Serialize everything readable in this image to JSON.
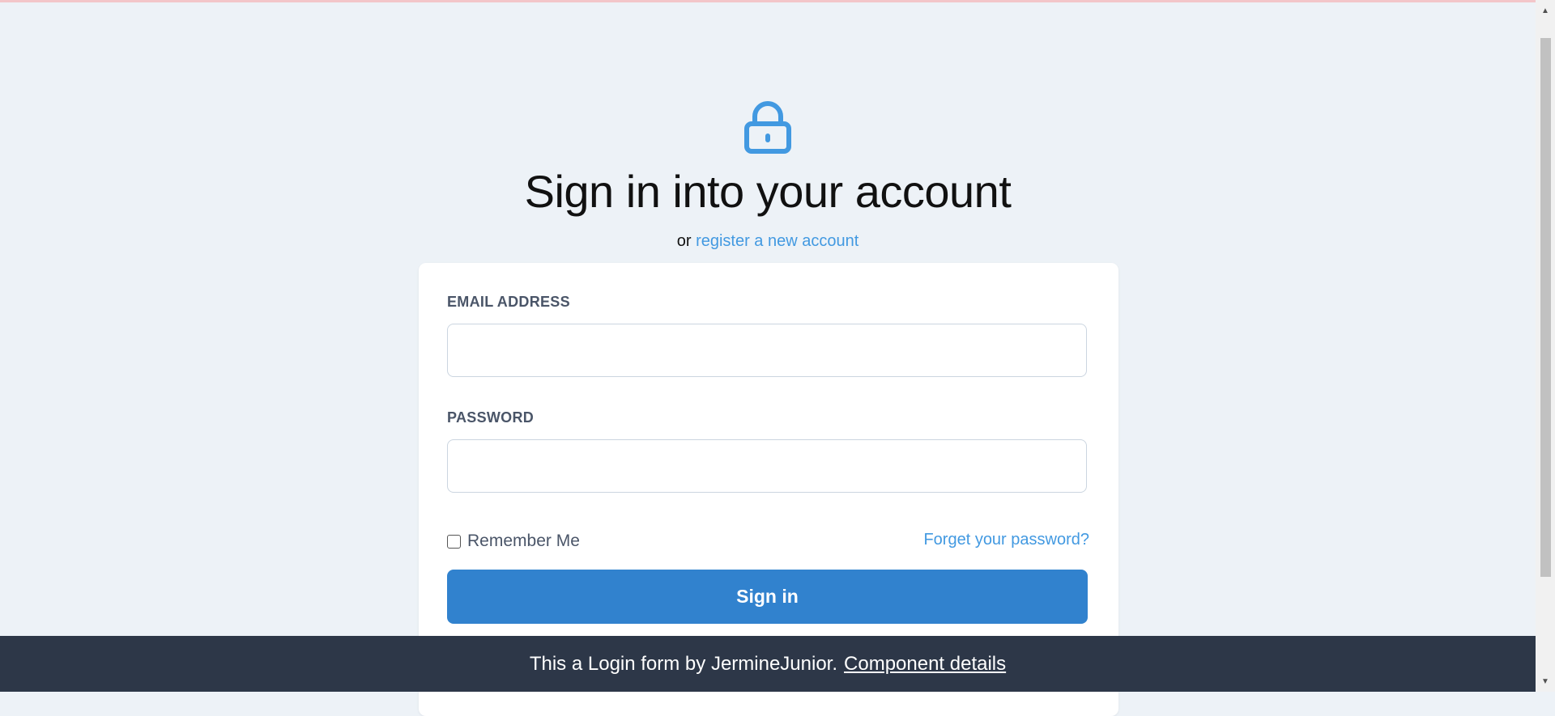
{
  "header": {
    "title": "Sign in into your account",
    "subtitle_prefix": "or",
    "register_link": "register a new account",
    "icon": "lock-icon"
  },
  "form": {
    "email_label": "EMAIL ADDRESS",
    "email_value": "",
    "password_label": "PASSWORD",
    "password_value": "",
    "remember_label": "Remember Me",
    "remember_checked": false,
    "forgot_link": "Forget your password?",
    "submit_label": "Sign in"
  },
  "footer": {
    "text": "This a Login form by JermineJunior.",
    "link": "Component details"
  },
  "colors": {
    "accent": "#3182ce",
    "link": "#4299e1",
    "background": "#edf2f7",
    "footer": "#2d3748"
  }
}
